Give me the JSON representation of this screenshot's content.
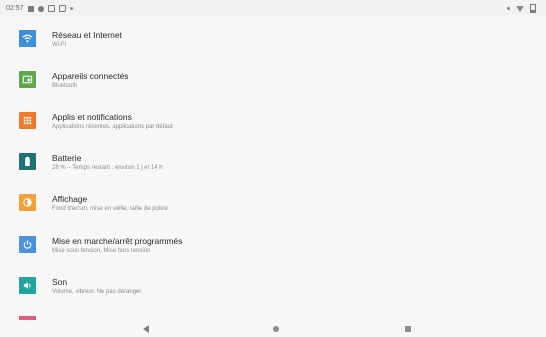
{
  "status_bar": {
    "time": "02:57",
    "left_icons": [
      "notification-icon",
      "gear-icon",
      "grid-icon",
      "grid-icon",
      "dot-icon"
    ],
    "right_icons": [
      "signal-icon",
      "wifi-icon",
      "battery-icon"
    ]
  },
  "settings": {
    "items": [
      {
        "title": "Réseau et Internet",
        "subtitle": "Wi-Fi",
        "icon": "wifi-icon",
        "color": "#3d8fde"
      },
      {
        "title": "Appareils connectés",
        "subtitle": "Bluetooth",
        "icon": "connected-devices-icon",
        "color": "#5fa84a"
      },
      {
        "title": "Applis et notifications",
        "subtitle": "Applications récentes, applications par défaut",
        "icon": "apps-icon",
        "color": "#ee7a2a"
      },
      {
        "title": "Batterie",
        "subtitle": "28 % – Temps restant : environ 1 j et 14 h",
        "icon": "battery-icon",
        "color": "#217074"
      },
      {
        "title": "Affichage",
        "subtitle": "Fond d'écran, mise en veille, taille de police",
        "icon": "display-icon",
        "color": "#f2a13a"
      },
      {
        "title": "Mise en marche/arrêt programmés",
        "subtitle": "Mise sous tension, Mise hors tension",
        "icon": "power-icon",
        "color": "#4d92dc"
      },
      {
        "title": "Son",
        "subtitle": "Volume, vibreur, Ne pas déranger",
        "icon": "sound-icon",
        "color": "#22a5a0"
      }
    ]
  },
  "nav_bar": {
    "back": "back-icon",
    "home": "home-icon",
    "recents": "recents-icon"
  }
}
